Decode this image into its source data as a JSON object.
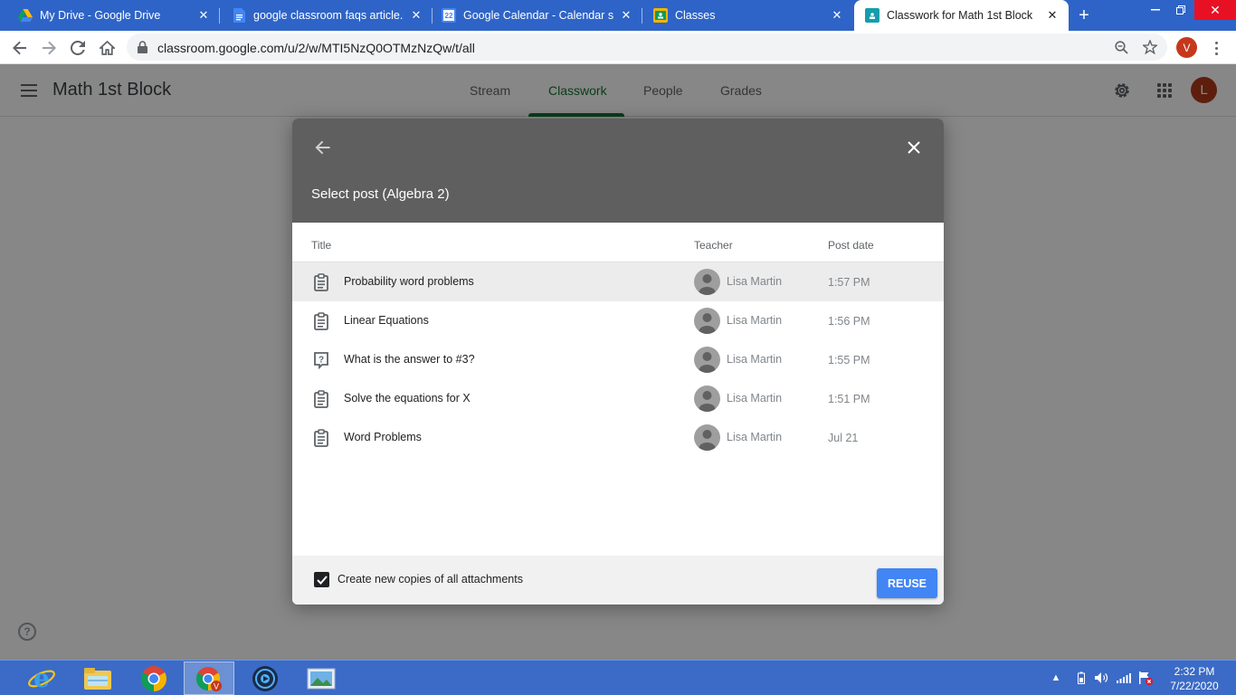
{
  "browser": {
    "tabs": [
      {
        "title": "My Drive - Google Drive",
        "icon": "google-drive-icon",
        "active": false
      },
      {
        "title": "google classroom faqs article.docx",
        "icon": "google-docs-icon",
        "active": false
      },
      {
        "title": "Google Calendar - Calendar settings",
        "icon": "google-calendar-icon",
        "icon_text": "22",
        "active": false
      },
      {
        "title": "Classes",
        "icon": "google-classroom-icon",
        "active": false
      },
      {
        "title": "Classwork for Math 1st Block",
        "icon": "google-classroom-icon",
        "active": true
      }
    ],
    "url": "classroom.google.com/u/2/w/MTI5NzQ0OTMzNzQw/t/all",
    "profile_initial": "V"
  },
  "classroom": {
    "class_title": "Math 1st Block",
    "nav_tabs": [
      "Stream",
      "Classwork",
      "People",
      "Grades"
    ],
    "active_tab": "Classwork",
    "user_initial": "L",
    "help_symbol": "?"
  },
  "dialog": {
    "title": "Select post (Algebra 2)",
    "columns": {
      "title": "Title",
      "teacher": "Teacher",
      "post_date": "Post date"
    },
    "posts": [
      {
        "title": "Probability word problems",
        "type": "assignment",
        "teacher": "Lisa Martin",
        "date": "1:57 PM",
        "selected": true
      },
      {
        "title": "Linear Equations",
        "type": "assignment",
        "teacher": "Lisa Martin",
        "date": "1:56 PM",
        "selected": false
      },
      {
        "title": "What is the answer to #3?",
        "type": "question",
        "teacher": "Lisa Martin",
        "date": "1:55 PM",
        "selected": false
      },
      {
        "title": "Solve the equations for X",
        "type": "assignment",
        "teacher": "Lisa Martin",
        "date": "1:51 PM",
        "selected": false
      },
      {
        "title": "Word Problems",
        "type": "assignment",
        "teacher": "Lisa Martin",
        "date": "Jul 21",
        "selected": false
      }
    ],
    "copy_attachments_label": "Create new copies of all attachments",
    "copy_attachments_checked": true,
    "reuse_label": "REUSE"
  },
  "taskbar": {
    "time": "2:32 PM",
    "date": "7/22/2020"
  },
  "colors": {
    "chrome_tabstrip": "#2e64c7",
    "classroom_green": "#137333",
    "reuse_blue": "#4285f4",
    "taskbar_blue": "#3b6bc6"
  }
}
